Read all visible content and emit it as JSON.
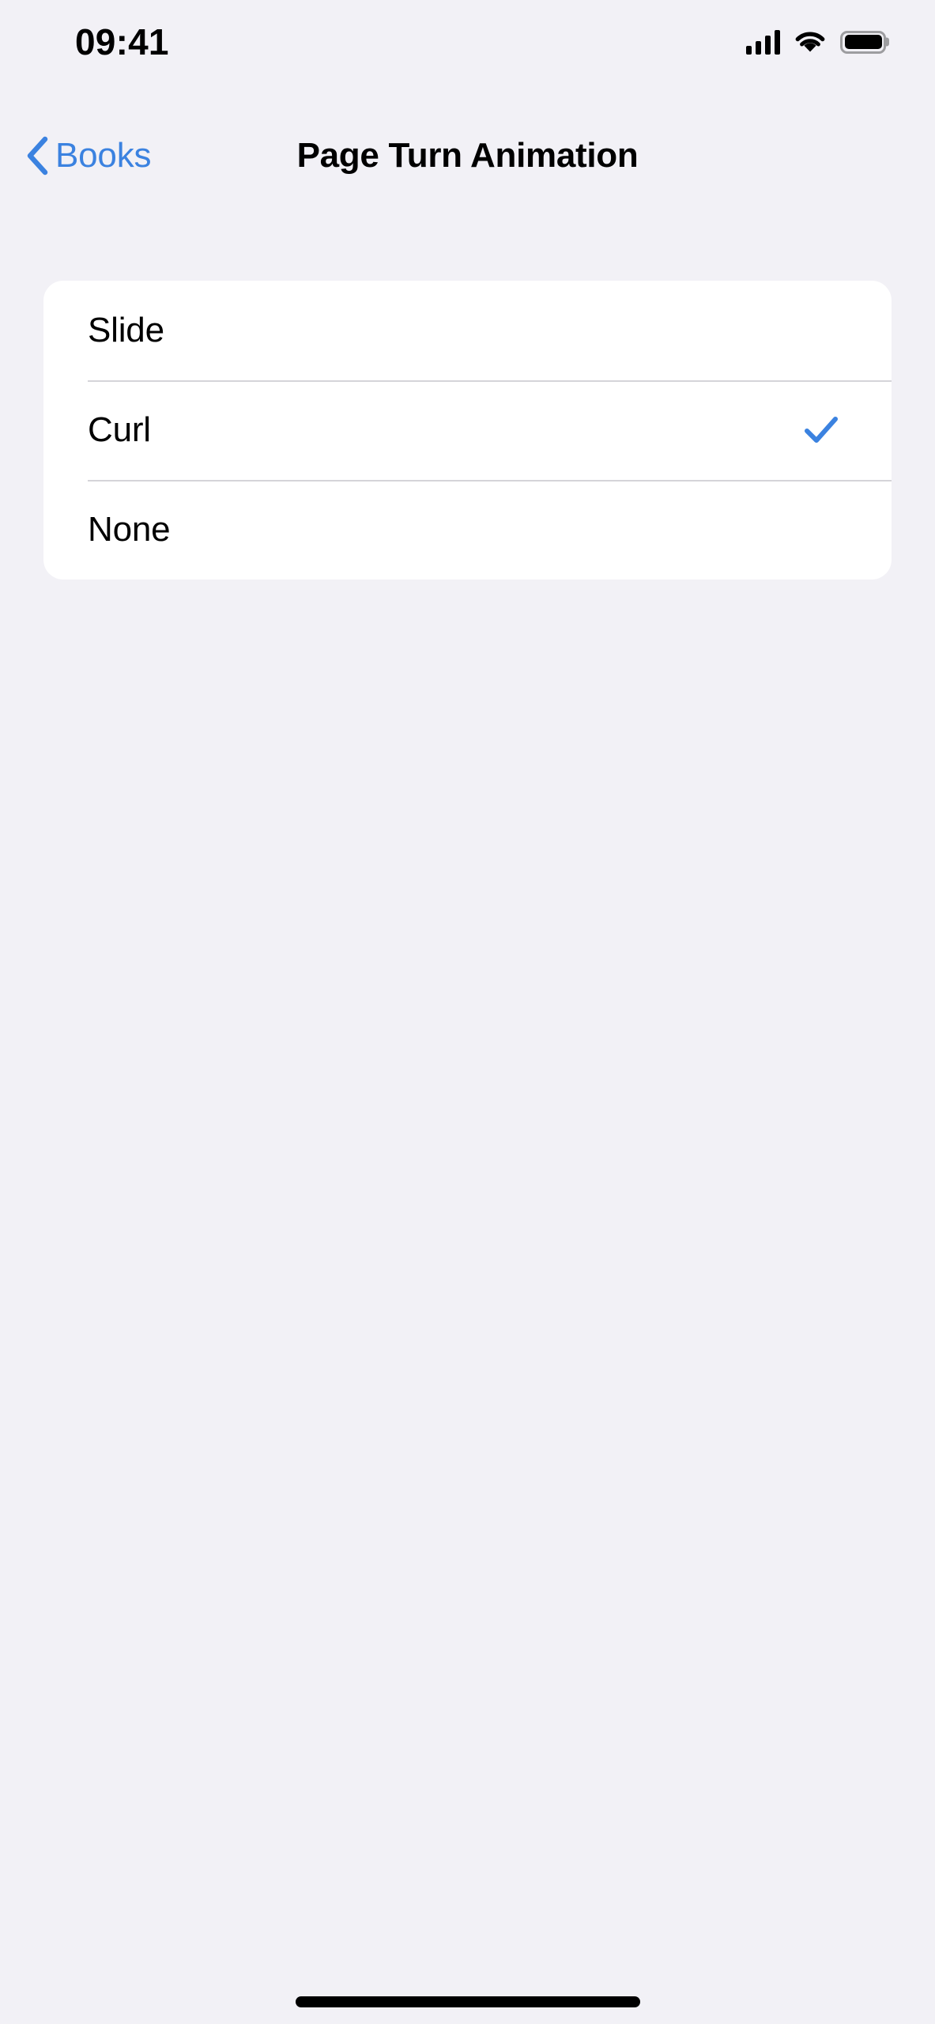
{
  "status_bar": {
    "time": "09:41",
    "cellular_icon": "cellular-bars-icon",
    "cellular_bars": 4,
    "wifi_icon": "wifi-icon",
    "battery_icon": "battery-icon",
    "battery_level_percent": 100
  },
  "nav": {
    "back_icon": "chevron-left-icon",
    "back_label": "Books",
    "title": "Page Turn Animation"
  },
  "settings_list": {
    "selected": "Curl",
    "checkmark_icon": "checkmark-icon",
    "options": [
      {
        "label": "Slide",
        "selected": false
      },
      {
        "label": "Curl",
        "selected": true
      },
      {
        "label": "None",
        "selected": false
      }
    ]
  },
  "home_indicator": {
    "name": "home-indicator"
  },
  "colors": {
    "background": "#f2f1f6",
    "card": "#ffffff",
    "accent_blue": "#3b82e0",
    "checkmark_blue": "#3b82e0",
    "separator": "#d5d4d9",
    "primary_text": "#000000"
  }
}
